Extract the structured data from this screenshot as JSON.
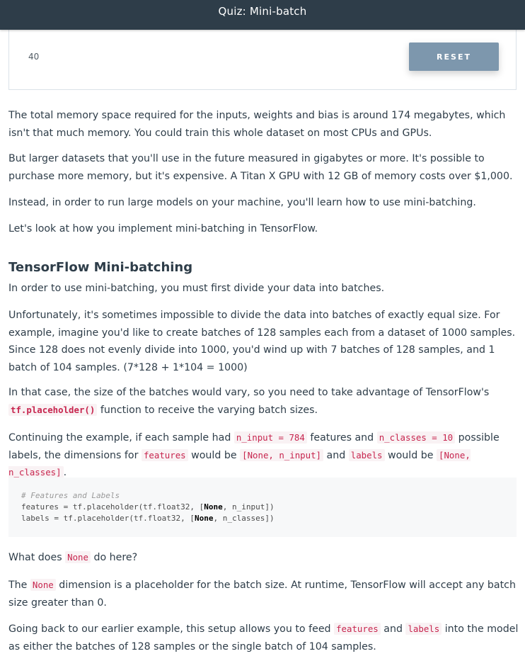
{
  "header": {
    "title": "Quiz: Mini-batch"
  },
  "quiz": {
    "value": "40",
    "reset_label": "RESET"
  },
  "paragraphs": {
    "p1": "The total memory space required for the inputs, weights and bias is around 174 megabytes, which isn't that much memory. You could train this whole dataset on most CPUs and GPUs.",
    "p2": "But larger datasets that you'll use in the future measured in gigabytes or more. It's possible to purchase more memory, but it's expensive. A Titan X GPU with 12 GB of memory costs over $1,000.",
    "p3": "Instead, in order to run large models on your machine, you'll learn how to use mini-batching.",
    "p4": "Let's look at how you implement mini-batching in TensorFlow.",
    "heading": "TensorFlow Mini-batching",
    "p5": "In order to use mini-batching, you must first divide your data into batches.",
    "p6": "Unfortunately, it's sometimes impossible to divide the data into batches of exactly equal size. For example, imagine you'd like to create batches of 128 samples each from a dataset of 1000 samples. Since 128 does not evenly divide into 1000, you'd wind up with 7 batches of 128 samples, and 1 batch of 104 samples. (7*128 + 1*104 = 1000)",
    "p7_a": "In that case, the size of the batches would vary, so you need to take advantage of TensorFlow's",
    "p7_code": "tf.placeholder()",
    "p7_b": " function to receive the varying batch sizes.",
    "p8_a": "Continuing the example, if each sample had ",
    "p8_code1": "n_input = 784",
    "p8_b": " features and ",
    "p8_code2": "n_classes = 10",
    "p8_c": " possible labels, the dimensions for ",
    "p8_code3": "features",
    "p8_d": " would be ",
    "p8_code4": "[None, n_input]",
    "p8_e": " and ",
    "p8_code5": "labels",
    "p8_f": " would be ",
    "p8_code6": "[None, n_classes]",
    "p8_g": ".",
    "p9_a": "What does ",
    "p9_code": "None",
    "p9_b": " do here?",
    "p10_a": "The ",
    "p10_code": "None",
    "p10_b": " dimension is a placeholder for the batch size. At runtime, TensorFlow will accept any batch size greater than 0.",
    "p11_a": "Going back to our earlier example, this setup allows you to feed ",
    "p11_code1": "features",
    "p11_b": " and ",
    "p11_code2": "labels",
    "p11_c": " into the model as either the batches of 128 samples or the single batch of 104 samples."
  },
  "code": {
    "comment": "# Features and Labels",
    "l1_a": "features = tf.placeholder(tf.float32, [",
    "l1_kw": "None",
    "l1_b": ", n_input])",
    "l2_a": "labels = tf.placeholder(tf.float32, [",
    "l2_kw": "None",
    "l2_b": ", n_classes])"
  }
}
